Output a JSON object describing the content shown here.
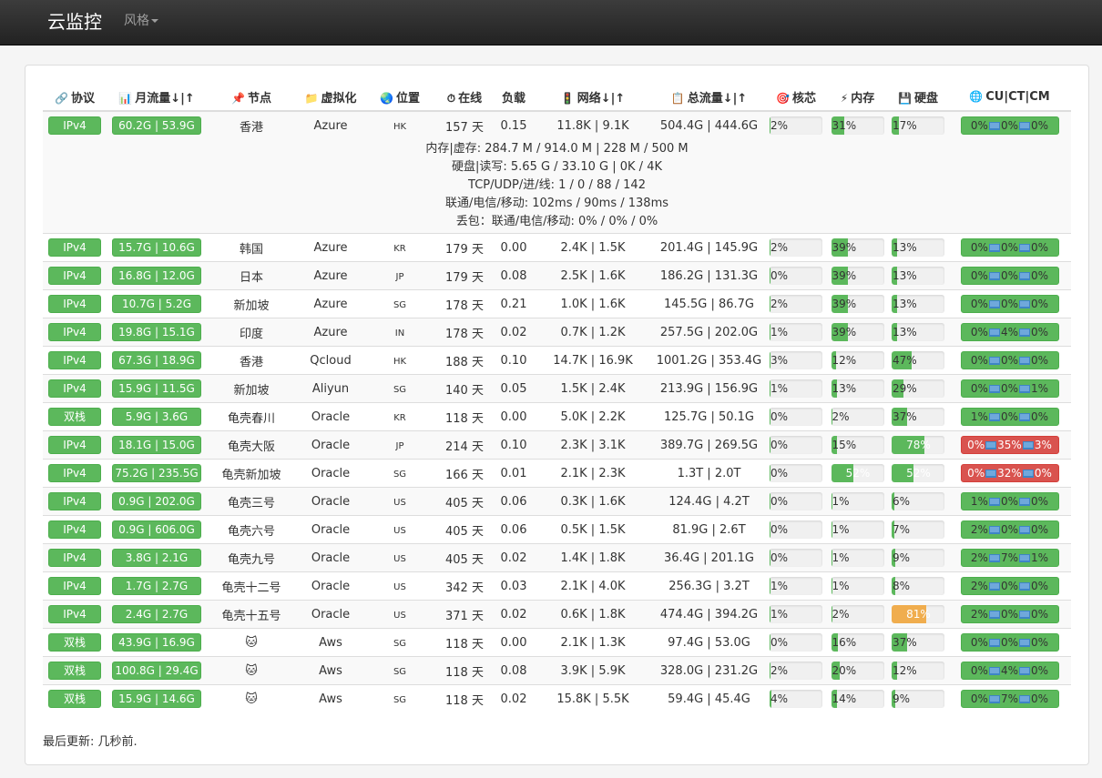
{
  "navbar": {
    "brand": "云监控",
    "style_menu": "风格"
  },
  "headers": {
    "protocol": "协议",
    "monthly": "月流量↓|↑",
    "node": "节点",
    "virt": "虚拟化",
    "location": "位置",
    "uptime": "在线",
    "load": "负载",
    "network": "网络↓|↑",
    "total": "总流量↓|↑",
    "cpu": "核芯",
    "memory": "内存",
    "disk": "硬盘",
    "cucucm": "CU|CT|CM"
  },
  "rows": [
    {
      "protocol": "IPv4",
      "monthly": "60.2G | 53.9G",
      "node": "香港",
      "virt": "Azure",
      "loc": "HK",
      "uptime": "157 天",
      "load": "0.15",
      "network": "11.8K | 9.1K",
      "total": "504.4G | 444.6G",
      "cpu": "2%",
      "cpu_v": 2,
      "mem": "31%",
      "mem_v": 31,
      "disk": "17%",
      "disk_v": 17,
      "cu": "0%",
      "ct": "0%",
      "cm": "0%"
    },
    {
      "protocol": "IPv4",
      "monthly": "15.7G | 10.6G",
      "node": "韩国",
      "virt": "Azure",
      "loc": "KR",
      "uptime": "179 天",
      "load": "0.00",
      "network": "2.4K | 1.5K",
      "total": "201.4G | 145.9G",
      "cpu": "2%",
      "cpu_v": 2,
      "mem": "39%",
      "mem_v": 39,
      "disk": "13%",
      "disk_v": 13,
      "cu": "0%",
      "ct": "0%",
      "cm": "0%"
    },
    {
      "protocol": "IPv4",
      "monthly": "16.8G | 12.0G",
      "node": "日本",
      "virt": "Azure",
      "loc": "JP",
      "uptime": "179 天",
      "load": "0.08",
      "network": "2.5K | 1.6K",
      "total": "186.2G | 131.3G",
      "cpu": "0%",
      "cpu_v": 0,
      "mem": "39%",
      "mem_v": 39,
      "disk": "13%",
      "disk_v": 13,
      "cu": "0%",
      "ct": "0%",
      "cm": "0%"
    },
    {
      "protocol": "IPv4",
      "monthly": "10.7G | 5.2G",
      "node": "新加坡",
      "virt": "Azure",
      "loc": "SG",
      "uptime": "178 天",
      "load": "0.21",
      "network": "1.0K | 1.6K",
      "total": "145.5G | 86.7G",
      "cpu": "2%",
      "cpu_v": 2,
      "mem": "39%",
      "mem_v": 39,
      "disk": "13%",
      "disk_v": 13,
      "cu": "0%",
      "ct": "0%",
      "cm": "0%"
    },
    {
      "protocol": "IPv4",
      "monthly": "19.8G | 15.1G",
      "node": "印度",
      "virt": "Azure",
      "loc": "IN",
      "uptime": "178 天",
      "load": "0.02",
      "network": "0.7K | 1.2K",
      "total": "257.5G | 202.0G",
      "cpu": "1%",
      "cpu_v": 1,
      "mem": "39%",
      "mem_v": 39,
      "disk": "13%",
      "disk_v": 13,
      "cu": "0%",
      "ct": "4%",
      "cm": "0%"
    },
    {
      "protocol": "IPv4",
      "monthly": "67.3G | 18.9G",
      "node": "香港",
      "virt": "Qcloud",
      "loc": "HK",
      "uptime": "188 天",
      "load": "0.10",
      "network": "14.7K | 16.9K",
      "total": "1001.2G | 353.4G",
      "cpu": "3%",
      "cpu_v": 3,
      "mem": "12%",
      "mem_v": 12,
      "disk": "47%",
      "disk_v": 47,
      "cu": "0%",
      "ct": "0%",
      "cm": "0%"
    },
    {
      "protocol": "IPv4",
      "monthly": "15.9G | 11.5G",
      "node": "新加坡",
      "virt": "Aliyun",
      "loc": "SG",
      "uptime": "140 天",
      "load": "0.05",
      "network": "1.5K | 2.4K",
      "total": "213.9G | 156.9G",
      "cpu": "1%",
      "cpu_v": 1,
      "mem": "13%",
      "mem_v": 13,
      "disk": "29%",
      "disk_v": 29,
      "cu": "0%",
      "ct": "0%",
      "cm": "1%"
    },
    {
      "protocol": "双栈",
      "monthly": "5.9G | 3.6G",
      "node": "龟壳春川",
      "virt": "Oracle",
      "loc": "KR",
      "uptime": "118 天",
      "load": "0.00",
      "network": "5.0K | 2.2K",
      "total": "125.7G | 50.1G",
      "cpu": "0%",
      "cpu_v": 0,
      "mem": "2%",
      "mem_v": 2,
      "disk": "37%",
      "disk_v": 37,
      "cu": "1%",
      "ct": "0%",
      "cm": "0%"
    },
    {
      "protocol": "IPv4",
      "monthly": "18.1G | 15.0G",
      "node": "龟壳大阪",
      "virt": "Oracle",
      "loc": "JP",
      "uptime": "214 天",
      "load": "0.10",
      "network": "2.3K | 3.1K",
      "total": "389.7G | 269.5G",
      "cpu": "0%",
      "cpu_v": 0,
      "mem": "15%",
      "mem_v": 15,
      "disk": "78%",
      "disk_v": 78,
      "cu": "0%",
      "ct": "35%",
      "cm": "3%",
      "cu_bad": true
    },
    {
      "protocol": "IPv4",
      "monthly": "75.2G | 235.5G",
      "node": "龟壳新加坡",
      "virt": "Oracle",
      "loc": "SG",
      "uptime": "166 天",
      "load": "0.01",
      "network": "2.1K | 2.3K",
      "total": "1.3T | 2.0T",
      "cpu": "0%",
      "cpu_v": 0,
      "mem": "52%",
      "mem_v": 52,
      "disk": "52%",
      "disk_v": 52,
      "cu": "0%",
      "ct": "32%",
      "cm": "0%",
      "cu_bad": true
    },
    {
      "protocol": "IPv4",
      "monthly": "0.9G | 202.0G",
      "node": "龟壳三号",
      "virt": "Oracle",
      "loc": "US",
      "uptime": "405 天",
      "load": "0.06",
      "network": "0.3K | 1.6K",
      "total": "124.4G | 4.2T",
      "cpu": "0%",
      "cpu_v": 0,
      "mem": "1%",
      "mem_v": 1,
      "disk": "6%",
      "disk_v": 6,
      "cu": "1%",
      "ct": "0%",
      "cm": "0%"
    },
    {
      "protocol": "IPv4",
      "monthly": "0.9G | 606.0G",
      "node": "龟壳六号",
      "virt": "Oracle",
      "loc": "US",
      "uptime": "405 天",
      "load": "0.06",
      "network": "0.5K | 1.5K",
      "total": "81.9G | 2.6T",
      "cpu": "0%",
      "cpu_v": 0,
      "mem": "1%",
      "mem_v": 1,
      "disk": "7%",
      "disk_v": 7,
      "cu": "2%",
      "ct": "0%",
      "cm": "0%"
    },
    {
      "protocol": "IPv4",
      "monthly": "3.8G | 2.1G",
      "node": "龟壳九号",
      "virt": "Oracle",
      "loc": "US",
      "uptime": "405 天",
      "load": "0.02",
      "network": "1.4K | 1.8K",
      "total": "36.4G | 201.1G",
      "cpu": "0%",
      "cpu_v": 0,
      "mem": "1%",
      "mem_v": 1,
      "disk": "9%",
      "disk_v": 9,
      "cu": "2%",
      "ct": "7%",
      "cm": "1%"
    },
    {
      "protocol": "IPv4",
      "monthly": "1.7G | 2.7G",
      "node": "龟壳十二号",
      "virt": "Oracle",
      "loc": "US",
      "uptime": "342 天",
      "load": "0.03",
      "network": "2.1K | 4.0K",
      "total": "256.3G | 3.2T",
      "cpu": "1%",
      "cpu_v": 1,
      "mem": "1%",
      "mem_v": 1,
      "disk": "8%",
      "disk_v": 8,
      "cu": "2%",
      "ct": "0%",
      "cm": "0%"
    },
    {
      "protocol": "IPv4",
      "monthly": "2.4G | 2.7G",
      "node": "龟壳十五号",
      "virt": "Oracle",
      "loc": "US",
      "uptime": "371 天",
      "load": "0.02",
      "network": "0.6K | 1.8K",
      "total": "474.4G | 394.2G",
      "cpu": "1%",
      "cpu_v": 1,
      "mem": "2%",
      "mem_v": 2,
      "disk": "81%",
      "disk_v": 81,
      "disk_warn": true,
      "cu": "2%",
      "ct": "0%",
      "cm": "0%"
    },
    {
      "protocol": "双栈",
      "monthly": "43.9G | 16.9G",
      "node": "🐱",
      "virt": "Aws",
      "loc": "SG",
      "uptime": "118 天",
      "load": "0.00",
      "network": "2.1K | 1.3K",
      "total": "97.4G | 53.0G",
      "cpu": "0%",
      "cpu_v": 0,
      "mem": "16%",
      "mem_v": 16,
      "disk": "37%",
      "disk_v": 37,
      "cu": "0%",
      "ct": "0%",
      "cm": "0%"
    },
    {
      "protocol": "双栈",
      "monthly": "100.8G | 29.4G",
      "node": "🐱",
      "virt": "Aws",
      "loc": "SG",
      "uptime": "118 天",
      "load": "0.08",
      "network": "3.9K | 5.9K",
      "total": "328.0G | 231.2G",
      "cpu": "2%",
      "cpu_v": 2,
      "mem": "20%",
      "mem_v": 20,
      "disk": "12%",
      "disk_v": 12,
      "cu": "0%",
      "ct": "4%",
      "cm": "0%"
    },
    {
      "protocol": "双栈",
      "monthly": "15.9G | 14.6G",
      "node": "🐱",
      "virt": "Aws",
      "loc": "SG",
      "uptime": "118 天",
      "load": "0.02",
      "network": "15.8K | 5.5K",
      "total": "59.4G | 45.4G",
      "cpu": "4%",
      "cpu_v": 4,
      "mem": "14%",
      "mem_v": 14,
      "disk": "9%",
      "disk_v": 9,
      "cu": "0%",
      "ct": "7%",
      "cm": "0%"
    }
  ],
  "detail": {
    "lines": [
      "内存|虚存: 284.7 M / 914.0 M | 228 M / 500 M",
      "硬盘|读写: 5.65 G / 33.10 G | 0K / 4K",
      "TCP/UDP/进/线: 1 / 0 / 88 / 142",
      "联通/电信/移动: 102ms / 90ms / 138ms",
      "丢包：联通/电信/移动: 0% / 0% / 0%"
    ]
  },
  "footer": "最后更新: 几秒前."
}
